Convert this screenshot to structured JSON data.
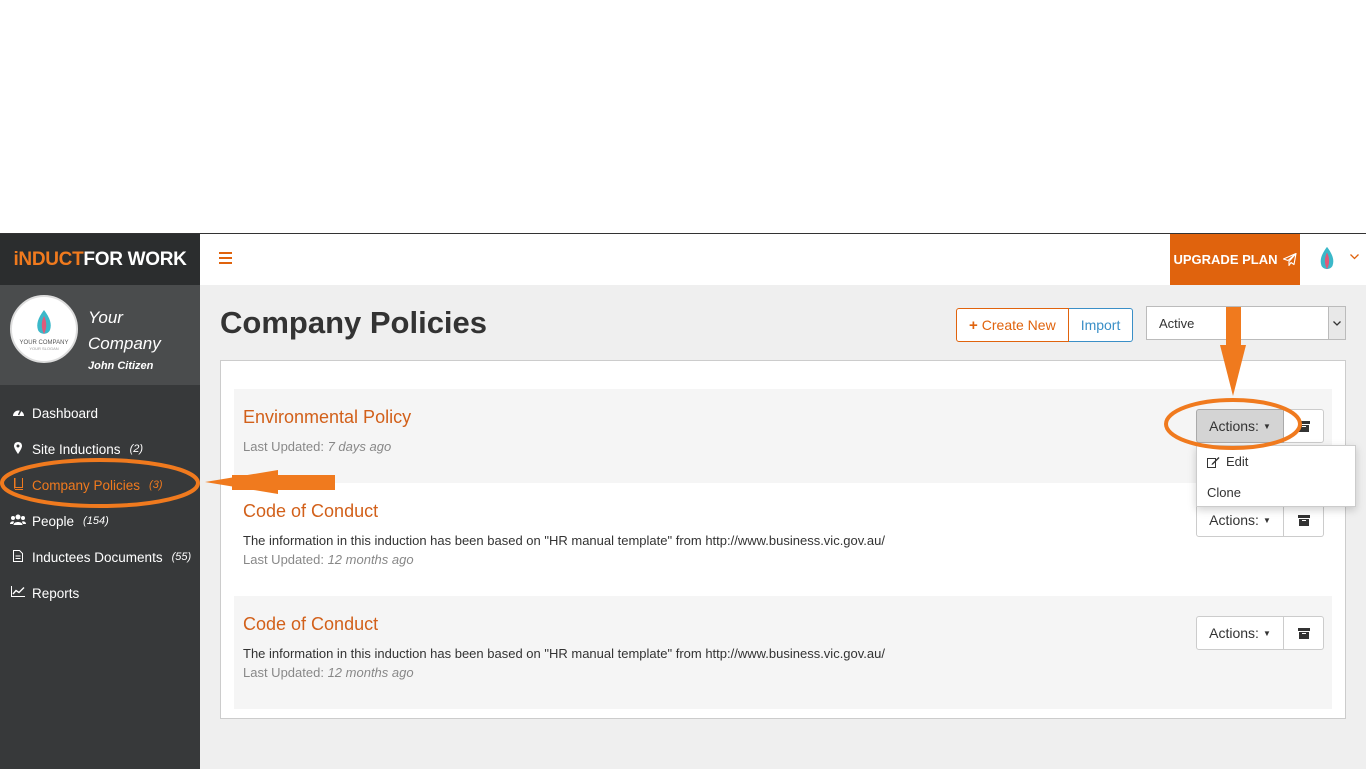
{
  "brand": {
    "part1": "iNDUCT",
    "part2": "FOR WORK"
  },
  "profile": {
    "company_line1": "Your",
    "company_line2": "Company",
    "user": "John Citizen",
    "logo_text": "YOUR COMPANY",
    "logo_sub": "YOUR SLOGAN"
  },
  "sidebar": {
    "items": [
      {
        "label": "Dashboard",
        "count": "",
        "icon": "dashboard-icon"
      },
      {
        "label": "Site Inductions",
        "count": "(2)",
        "icon": "map-pin-icon"
      },
      {
        "label": "Company Policies",
        "count": "(3)",
        "icon": "book-icon"
      },
      {
        "label": "People",
        "count": "(154)",
        "icon": "users-icon"
      },
      {
        "label": "Inductees Documents",
        "count": "(55)",
        "icon": "document-icon"
      },
      {
        "label": "Reports",
        "count": "",
        "icon": "chart-line-icon"
      }
    ]
  },
  "topbar": {
    "upgrade_label": "UPGRADE PLAN"
  },
  "page": {
    "title": "Company Policies",
    "create_label": "Create New",
    "import_label": "Import",
    "status_value": "Active"
  },
  "policies": [
    {
      "title": "Environmental Policy",
      "description": "",
      "updated_prefix": "Last Updated:",
      "updated_value": "7 days ago",
      "actions_label": "Actions:"
    },
    {
      "title": "Code of Conduct",
      "description": "The information in this induction has been based on \"HR manual template\" from http://www.business.vic.gov.au/",
      "updated_prefix": "Last Updated:",
      "updated_value": "12 months ago",
      "actions_label": "Actions:"
    },
    {
      "title": "Code of Conduct",
      "description": "The information in this induction has been based on \"HR manual template\" from http://www.business.vic.gov.au/",
      "updated_prefix": "Last Updated:",
      "updated_value": "12 months ago",
      "actions_label": "Actions:"
    }
  ],
  "dropdown": {
    "edit_label": "Edit",
    "clone_label": "Clone"
  },
  "colors": {
    "accent": "#e0630d",
    "sidebar": "#37393a",
    "link": "#3a8fc7",
    "annotation": "#f07a1e"
  }
}
